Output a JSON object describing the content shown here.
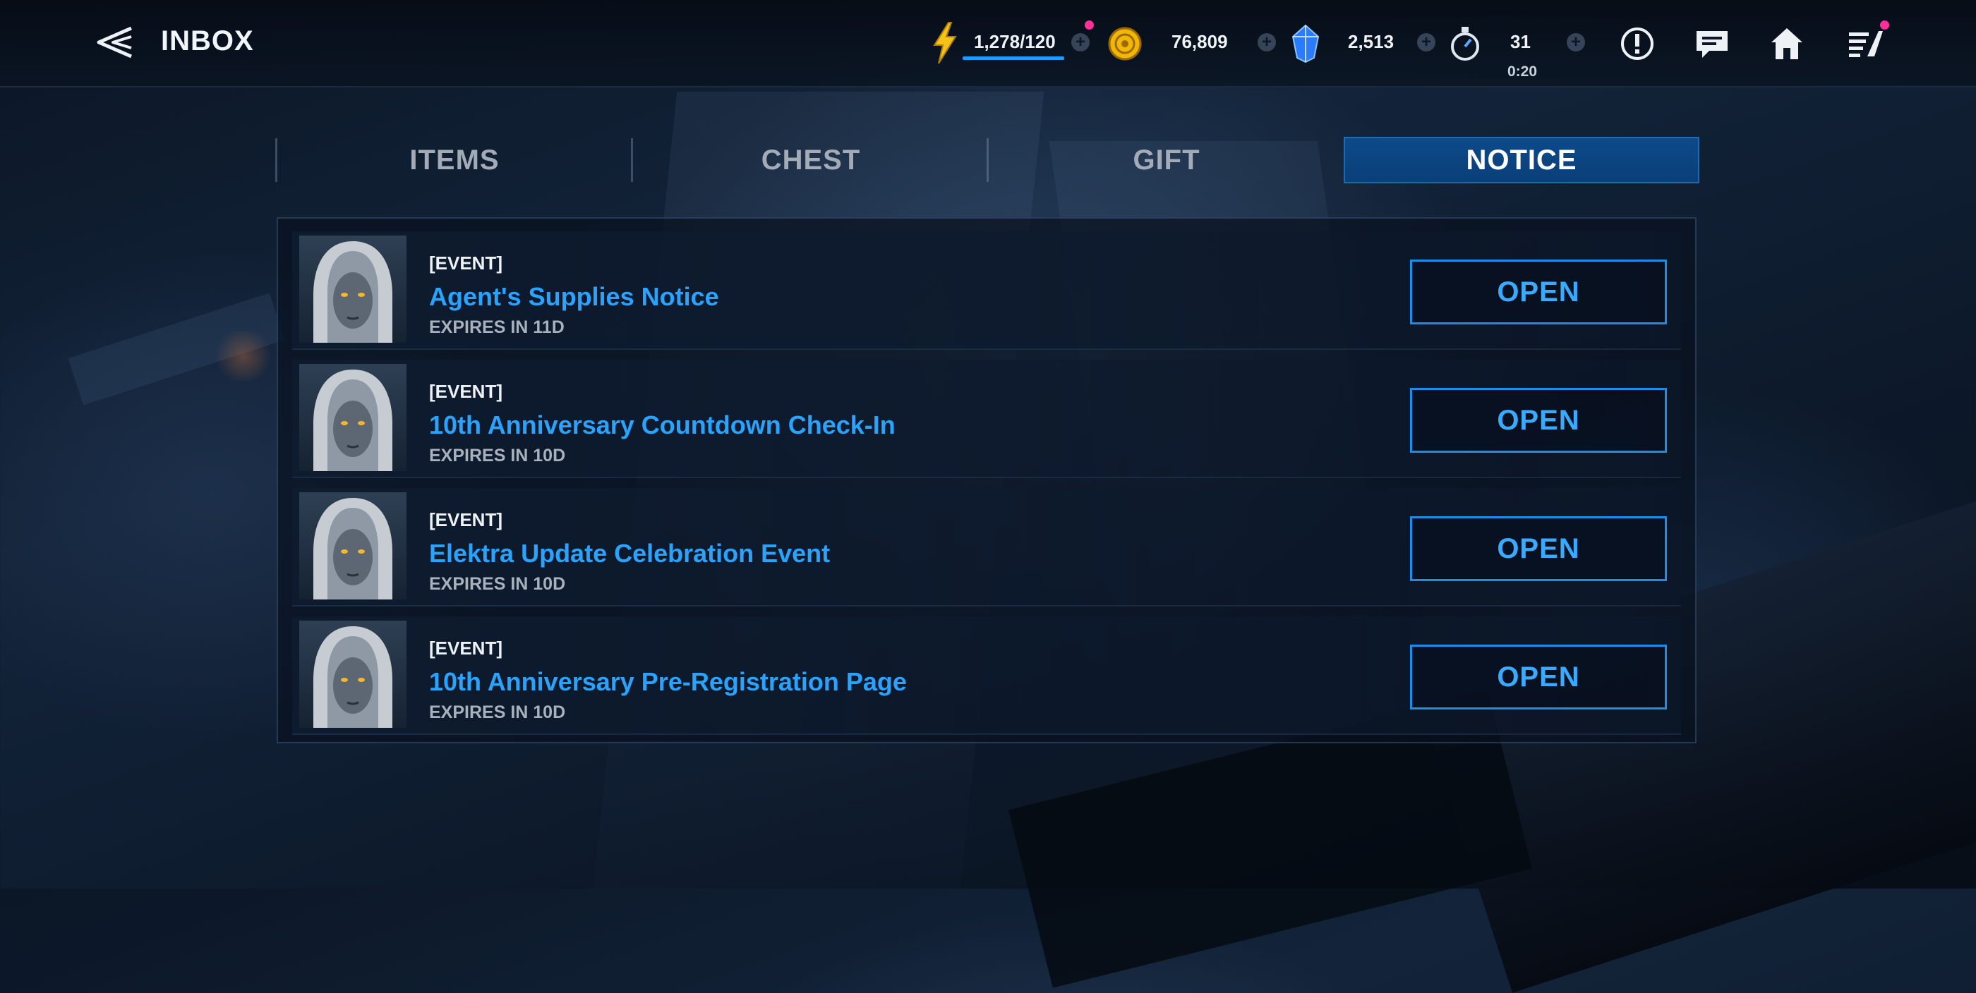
{
  "header": {
    "title": "INBOX",
    "back_icon": "back-arrow-icon"
  },
  "resources": {
    "energy": {
      "value": "1,278/120",
      "icon": "lightning-icon",
      "color": "#f5c21a"
    },
    "gold": {
      "value": "76,809",
      "icon": "gold-coin-icon",
      "color": "#f2b705"
    },
    "crystal": {
      "value": "2,513",
      "icon": "blue-crystal-icon",
      "color": "#2a7bff"
    },
    "stamina": {
      "value": "31",
      "timer": "0:20",
      "icon": "stopwatch-icon"
    }
  },
  "top_actions": [
    {
      "icon": "alert-icon"
    },
    {
      "icon": "chat-icon"
    },
    {
      "icon": "home-icon"
    },
    {
      "icon": "menu-icon"
    }
  ],
  "tabs": [
    {
      "label": "ITEMS",
      "active": false
    },
    {
      "label": "CHEST",
      "active": false
    },
    {
      "label": "GIFT",
      "active": false
    },
    {
      "label": "NOTICE",
      "active": true
    }
  ],
  "messages": [
    {
      "tag": "[EVENT]",
      "title": "Agent's Supplies Notice",
      "expiry": "EXPIRES IN 11D",
      "button": "OPEN"
    },
    {
      "tag": "[EVENT]",
      "title": "10th Anniversary Countdown Check-In",
      "expiry": "EXPIRES IN 10D",
      "button": "OPEN"
    },
    {
      "tag": "[EVENT]",
      "title": "Elektra Update Celebration Event",
      "expiry": "EXPIRES IN 10D",
      "button": "OPEN"
    },
    {
      "tag": "[EVENT]",
      "title": "10th Anniversary Pre-Registration Page",
      "expiry": "EXPIRES IN 10D",
      "button": "OPEN"
    }
  ],
  "colors": {
    "accent_blue": "#2aa3ff",
    "active_tab": "#0d4a8a",
    "notification_dot": "#ff2f9a"
  }
}
